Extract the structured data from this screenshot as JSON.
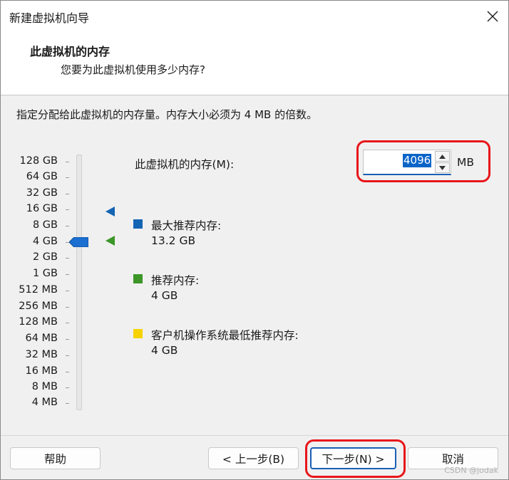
{
  "window": {
    "title": "新建虚拟机向导"
  },
  "header": {
    "title": "此虚拟机的内存",
    "subtitle": "您要为此虚拟机使用多少内存?"
  },
  "instruction": "指定分配给此虚拟机的内存量。内存大小必须为 4 MB 的倍数。",
  "scale": [
    "128 GB",
    "64 GB",
    "32 GB",
    "16 GB",
    "8 GB",
    "4 GB",
    "2 GB",
    "1 GB",
    "512 MB",
    "256 MB",
    "128 MB",
    "64 MB",
    "32 MB",
    "16 MB",
    "8 MB",
    "4 MB"
  ],
  "slider": {
    "selected": "4 GB"
  },
  "memory": {
    "label": "此虚拟机的内存(M):",
    "value": "4096",
    "unit": "MB"
  },
  "legend": [
    {
      "label": "最大推荐内存:",
      "value": "13.2 GB",
      "color": "#1464b4"
    },
    {
      "label": "推荐内存:",
      "value": "4 GB",
      "color": "#3c9628"
    },
    {
      "label": "客户机操作系统最低推荐内存:",
      "value": "4 GB",
      "color": "#f5d200"
    }
  ],
  "buttons": {
    "help": "帮助",
    "back": "< 上一步(B)",
    "next": "下一步(N) >",
    "cancel": "取消"
  },
  "watermark": "CSDN @jodak"
}
